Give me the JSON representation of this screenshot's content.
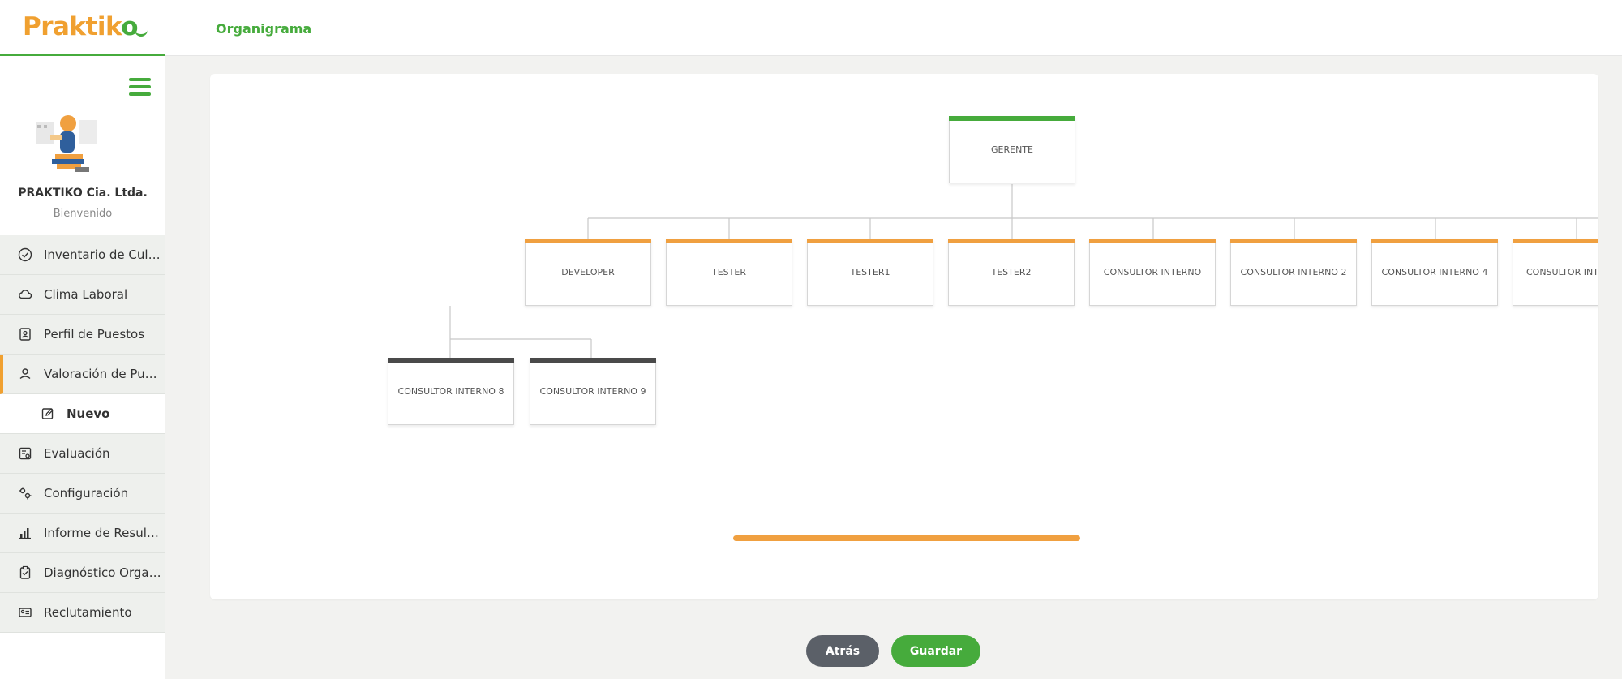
{
  "app": {
    "logo": "Praktiko",
    "brand_colors": {
      "green": "#46ab3c",
      "orange": "#f0a040",
      "dark": "#4a4a4a"
    }
  },
  "sidebar": {
    "company": "PRAKTIKO Cia. Ltda.",
    "welcome": "Bienvenido",
    "items": [
      {
        "label": "Inventario de Cultu...",
        "icon": "check-circle-icon"
      },
      {
        "label": "Clima Laboral",
        "icon": "cloud-icon"
      },
      {
        "label": "Perfil de Puestos",
        "icon": "id-badge-icon"
      },
      {
        "label": "Valoración de Pues...",
        "icon": "user-location-icon",
        "active": true
      },
      {
        "label": "Nuevo",
        "icon": "edit-icon",
        "sub": true
      },
      {
        "label": "Evaluación",
        "icon": "evaluation-icon"
      },
      {
        "label": "Configuración",
        "icon": "gears-icon"
      },
      {
        "label": "Informe de Resulta...",
        "icon": "bar-chart-icon"
      },
      {
        "label": "Diagnóstico Organi...",
        "icon": "clipboard-check-icon"
      },
      {
        "label": "Reclutamiento",
        "icon": "id-card-icon"
      }
    ]
  },
  "header": {
    "title": "Organigrama"
  },
  "org_chart": {
    "root": "GERENTE",
    "level1": [
      "DEVELOPER",
      "TESTER",
      "TESTER1",
      "TESTER2",
      "CONSULTOR INTERNO",
      "CONSULTOR INTERNO 2",
      "CONSULTOR INTERNO 4",
      "CONSULTOR INTE"
    ],
    "level2": [
      "CONSULTOR INTERNO 8",
      "CONSULTOR INTERNO 9"
    ]
  },
  "actions": {
    "back": "Atrás",
    "save": "Guardar"
  }
}
